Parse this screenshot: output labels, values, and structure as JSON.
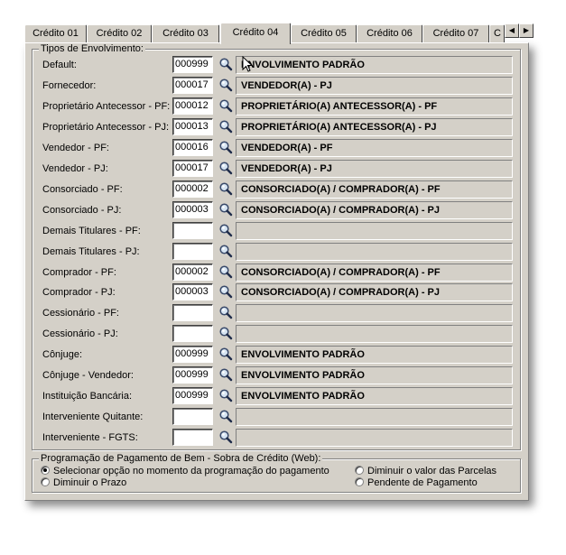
{
  "tabs": [
    {
      "label": "Crédito 01"
    },
    {
      "label": "Crédito 02"
    },
    {
      "label": "Crédito 03"
    },
    {
      "label": "Crédito 04"
    },
    {
      "label": "Crédito 05"
    },
    {
      "label": "Crédito 06"
    },
    {
      "label": "Crédito 07"
    },
    {
      "label": "C"
    }
  ],
  "tabs_scroll": {
    "left_icon": "arrow-left-icon",
    "right_icon": "arrow-right-icon"
  },
  "envolvimento": {
    "legend": "Tipos de Envolvimento:",
    "rows": [
      {
        "label": "Default:",
        "code": "000999",
        "desc": "ENVOLVIMENTO PADRÃO"
      },
      {
        "label": "Fornecedor:",
        "code": "000017",
        "desc": "VENDEDOR(A) - PJ"
      },
      {
        "label": "Proprietário Antecessor - PF:",
        "code": "000012",
        "desc": "PROPRIETÁRIO(A) ANTECESSOR(A) - PF"
      },
      {
        "label": "Proprietário Antecessor - PJ:",
        "code": "000013",
        "desc": "PROPRIETÁRIO(A) ANTECESSOR(A) - PJ"
      },
      {
        "label": "Vendedor - PF:",
        "code": "000016",
        "desc": "VENDEDOR(A) - PF"
      },
      {
        "label": "Vendedor - PJ:",
        "code": "000017",
        "desc": "VENDEDOR(A) - PJ"
      },
      {
        "label": "Consorciado - PF:",
        "code": "000002",
        "desc": "CONSORCIADO(A) / COMPRADOR(A) - PF"
      },
      {
        "label": "Consorciado - PJ:",
        "code": "000003",
        "desc": "CONSORCIADO(A) / COMPRADOR(A) - PJ"
      },
      {
        "label": "Demais Titulares - PF:",
        "code": "",
        "desc": ""
      },
      {
        "label": "Demais Titulares - PJ:",
        "code": "",
        "desc": ""
      },
      {
        "label": "Comprador - PF:",
        "code": "000002",
        "desc": "CONSORCIADO(A) / COMPRADOR(A) - PF"
      },
      {
        "label": "Comprador - PJ:",
        "code": "000003",
        "desc": "CONSORCIADO(A) / COMPRADOR(A) - PJ"
      },
      {
        "label": "Cessionário - PF:",
        "code": "",
        "desc": ""
      },
      {
        "label": "Cessionário - PJ:",
        "code": "",
        "desc": ""
      },
      {
        "label": "Cônjuge:",
        "code": "000999",
        "desc": "ENVOLVIMENTO PADRÃO"
      },
      {
        "label": "Cônjuge - Vendedor:",
        "code": "000999",
        "desc": "ENVOLVIMENTO PADRÃO"
      },
      {
        "label": "Instituição Bancária:",
        "code": "000999",
        "desc": "ENVOLVIMENTO PADRÃO"
      },
      {
        "label": "Interveniente Quitante:",
        "code": "",
        "desc": ""
      },
      {
        "label": "Interveniente - FGTS:",
        "code": "",
        "desc": ""
      }
    ],
    "search_icon": "magnifier-icon"
  },
  "programacao": {
    "legend": "Programação de Pagamento de Bem - Sobra de Crédito (Web):",
    "options": [
      {
        "label": "Selecionar opção no momento da programação do pagamento",
        "selected": true
      },
      {
        "label": "Diminuir o valor das Parcelas",
        "selected": false
      },
      {
        "label": "Diminuir o Prazo",
        "selected": false
      },
      {
        "label": "Pendente de Pagamento",
        "selected": false
      }
    ]
  },
  "colors": {
    "face": "#d4d0c8",
    "shadow": "#808080",
    "highlight": "#ffffff"
  }
}
